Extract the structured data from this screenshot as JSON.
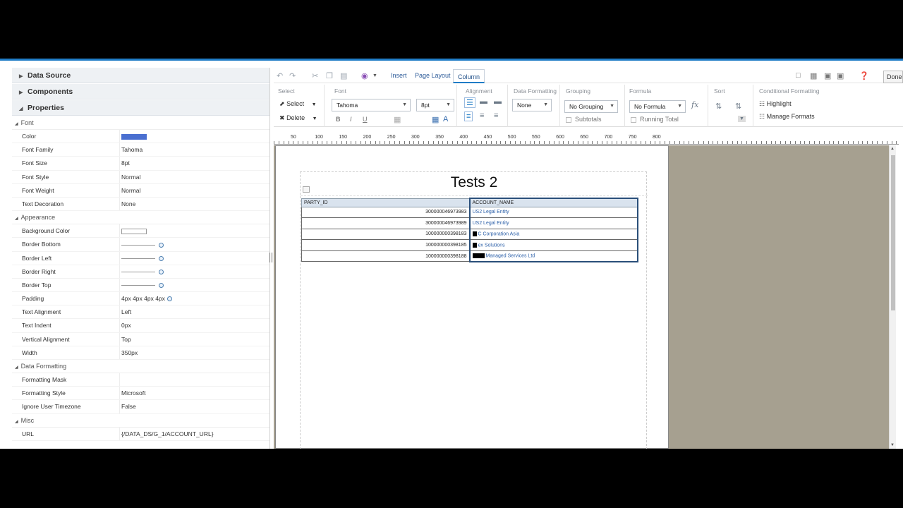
{
  "left_panel": {
    "sections": {
      "data_source": "Data Source",
      "components": "Components",
      "properties": "Properties"
    },
    "groups": {
      "font": "Font",
      "appearance": "Appearance",
      "data_formatting": "Data Formatting",
      "misc": "Misc"
    },
    "font_props": [
      {
        "key": "Color",
        "value": ""
      },
      {
        "key": "Font Family",
        "value": "Tahoma"
      },
      {
        "key": "Font Size",
        "value": "8pt"
      },
      {
        "key": "Font Style",
        "value": "Normal"
      },
      {
        "key": "Font Weight",
        "value": "Normal"
      },
      {
        "key": "Text Decoration",
        "value": "None"
      }
    ],
    "appearance_props": [
      {
        "key": "Background Color",
        "value": ""
      },
      {
        "key": "Border Bottom",
        "value": ""
      },
      {
        "key": "Border Left",
        "value": ""
      },
      {
        "key": "Border Right",
        "value": ""
      },
      {
        "key": "Border Top",
        "value": ""
      },
      {
        "key": "Padding",
        "value": "4px 4px 4px 4px"
      },
      {
        "key": "Text Alignment",
        "value": "Left"
      },
      {
        "key": "Text Indent",
        "value": "0px"
      },
      {
        "key": "Vertical Alignment",
        "value": "Top"
      },
      {
        "key": "Width",
        "value": "350px"
      }
    ],
    "data_formatting_props": [
      {
        "key": "Formatting Mask",
        "value": ""
      },
      {
        "key": "Formatting Style",
        "value": "Microsoft"
      },
      {
        "key": "Ignore User Timezone",
        "value": "False"
      }
    ],
    "misc_props": [
      {
        "key": "URL",
        "value": "{/DATA_DS/G_1/ACCOUNT_URL}"
      }
    ],
    "color_swatch": "#4a6fd0"
  },
  "toolbar": {
    "tabs": [
      "Insert",
      "Page Layout",
      "Column"
    ],
    "done": "Done"
  },
  "ribbon": {
    "select_section": "Select",
    "select_btn": "Select",
    "delete_btn": "Delete",
    "font_section": "Font",
    "font_family": "Tahoma",
    "font_size": "8pt",
    "bold": "B",
    "italic": "I",
    "underline": "U",
    "alignment_section": "Alignment",
    "data_formatting_section": "Data Formatting",
    "data_formatting_value": "None",
    "grouping_section": "Grouping",
    "grouping_value": "No Grouping",
    "subtotals": "Subtotals",
    "formula_section": "Formula",
    "formula_value": "No Formula",
    "running_total": "Running Total",
    "sort_section": "Sort",
    "cond_section": "Conditional Formatting",
    "highlight": "Highlight",
    "manage_formats": "Manage Formats"
  },
  "ruler": [
    "50",
    "100",
    "150",
    "200",
    "250",
    "300",
    "350",
    "400",
    "450",
    "500",
    "550",
    "600",
    "650",
    "700",
    "750",
    "800"
  ],
  "report": {
    "title": "Tests 2",
    "columns": [
      "PARTY_ID",
      "ACCOUNT_NAME"
    ],
    "rows": [
      {
        "party_id": "300000046973983",
        "account_name": "US2 Legal Entity",
        "redact": 0
      },
      {
        "party_id": "300000046973989",
        "account_name": "US2 Legal Entity",
        "redact": 0
      },
      {
        "party_id": "100000000398183",
        "account_name": "C Corporation Asia",
        "redact": 1
      },
      {
        "party_id": "100000000398185",
        "account_name": "ex Solutions",
        "redact": 1
      },
      {
        "party_id": "100000000398188",
        "account_name": "Managed Services Ltd",
        "redact": 2
      }
    ]
  }
}
